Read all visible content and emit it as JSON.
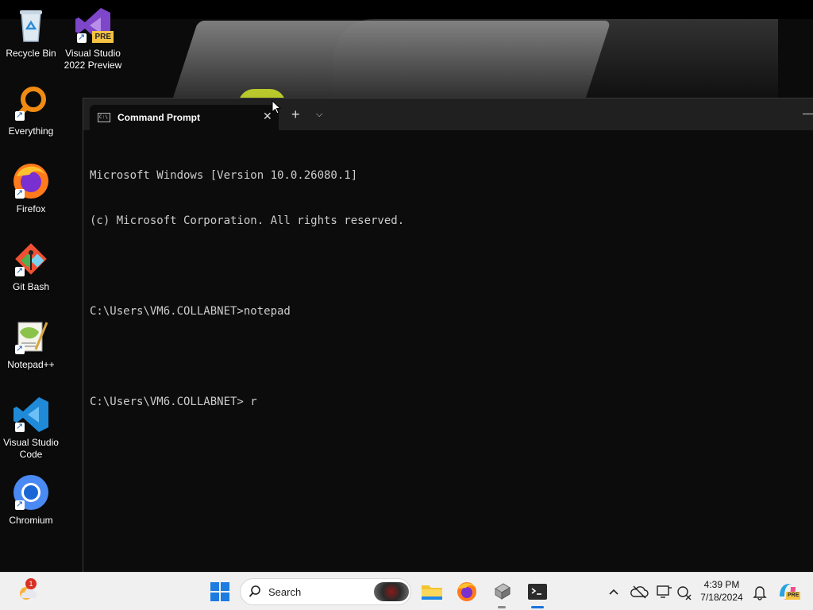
{
  "desktop": {
    "icons": [
      {
        "label": "Recycle Bin"
      },
      {
        "label": "Visual Studio 2022 Preview",
        "badge": "PRE"
      },
      {
        "label": "Everything"
      },
      {
        "label": "Firefox"
      },
      {
        "label": "Git Bash"
      },
      {
        "label": "Notepad++"
      },
      {
        "label": "Visual Studio Code"
      },
      {
        "label": "Chromium"
      }
    ]
  },
  "terminal": {
    "tab_title": "Command Prompt",
    "tab_icon_text": "C:\\",
    "lines": [
      "Microsoft Windows [Version 10.0.26080.1]",
      "(c) Microsoft Corporation. All rights reserved.",
      "",
      "C:\\Users\\VM6.COLLABNET>notepad",
      "",
      "C:\\Users\\VM6.COLLABNET> r"
    ]
  },
  "taskbar": {
    "search_placeholder": "Search",
    "notification_badge": "1",
    "time": "4:39 PM",
    "date": "7/18/2024",
    "copilot_badge": "PRE"
  },
  "colors": {
    "terminal_bg": "#0c0c0c",
    "terminal_text": "#cccccc",
    "taskbar_bg": "#f0f0f0",
    "accent": "#1a73d9"
  }
}
